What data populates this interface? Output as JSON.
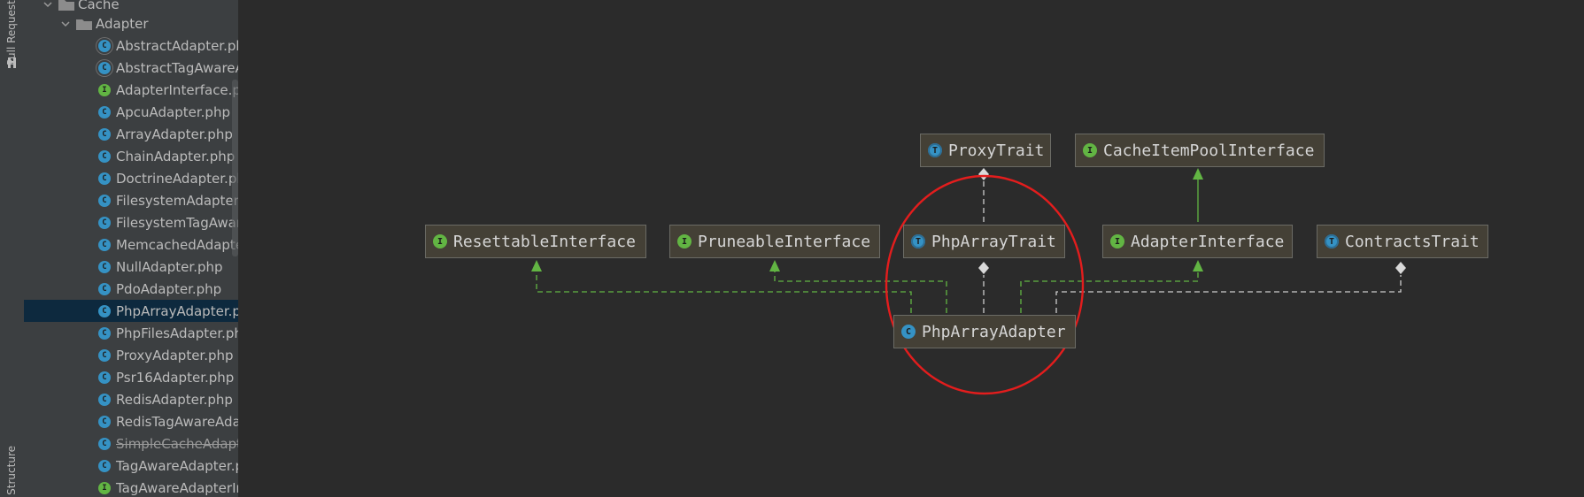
{
  "tool_strip": {
    "pull_requests_label": "Pull Requests",
    "structure_label": "Structure"
  },
  "tree": {
    "items": [
      {
        "label": "Cache",
        "kind": "folder",
        "expanded": true
      },
      {
        "label": "Adapter",
        "kind": "folder",
        "expanded": true
      },
      {
        "label": "AbstractAdapter.php",
        "kind": "abstract-class"
      },
      {
        "label": "AbstractTagAwareAdapter.php",
        "kind": "abstract-class"
      },
      {
        "label": "AdapterInterface.php",
        "kind": "interface"
      },
      {
        "label": "ApcuAdapter.php",
        "kind": "class"
      },
      {
        "label": "ArrayAdapter.php",
        "kind": "class"
      },
      {
        "label": "ChainAdapter.php",
        "kind": "class"
      },
      {
        "label": "DoctrineAdapter.php",
        "kind": "class"
      },
      {
        "label": "FilesystemAdapter.php",
        "kind": "class"
      },
      {
        "label": "FilesystemTagAwareAdapter.php",
        "kind": "class"
      },
      {
        "label": "MemcachedAdapter.php",
        "kind": "class"
      },
      {
        "label": "NullAdapter.php",
        "kind": "class"
      },
      {
        "label": "PdoAdapter.php",
        "kind": "class"
      },
      {
        "label": "PhpArrayAdapter.php",
        "kind": "class",
        "selected": true
      },
      {
        "label": "PhpFilesAdapter.php",
        "kind": "class"
      },
      {
        "label": "ProxyAdapter.php",
        "kind": "class"
      },
      {
        "label": "Psr16Adapter.php",
        "kind": "class"
      },
      {
        "label": "RedisAdapter.php",
        "kind": "class"
      },
      {
        "label": "RedisTagAwareAdapter.php",
        "kind": "class"
      },
      {
        "label": "SimpleCacheAdapter.php",
        "kind": "class",
        "deprecated": true
      },
      {
        "label": "TagAwareAdapter.php",
        "kind": "class"
      },
      {
        "label": "TagAwareAdapterInterface.php",
        "kind": "interface"
      }
    ],
    "selection_color": "#0d293e"
  },
  "diagram": {
    "nodes": {
      "proxy_trait": {
        "label": "ProxyTrait",
        "kind": "trait"
      },
      "cache_item_pool_interface": {
        "label": "CacheItemPoolInterface",
        "kind": "interface"
      },
      "resettable_interface": {
        "label": "ResettableInterface",
        "kind": "interface"
      },
      "pruneable_interface": {
        "label": "PruneableInterface",
        "kind": "interface"
      },
      "php_array_trait": {
        "label": "PhpArrayTrait",
        "kind": "trait"
      },
      "adapter_interface": {
        "label": "AdapterInterface",
        "kind": "interface"
      },
      "contracts_trait": {
        "label": "ContractsTrait",
        "kind": "trait"
      },
      "php_array_adapter": {
        "label": "PhpArrayAdapter",
        "kind": "class"
      }
    },
    "colors": {
      "implements_edge": "#62b543",
      "uses_edge": "#cccccc",
      "highlight_circle": "#e31d1d",
      "node_fill": "#444036"
    }
  }
}
